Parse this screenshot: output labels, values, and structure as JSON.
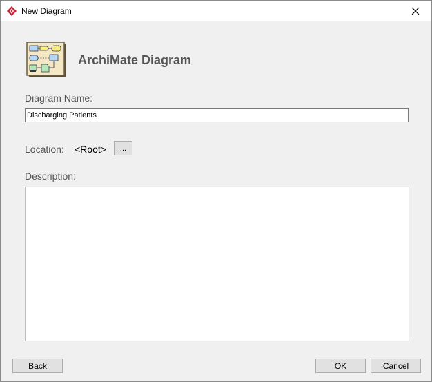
{
  "window": {
    "title": "New Diagram",
    "app_icon": "visual-paradigm-diamond-icon",
    "close_icon": "close-icon"
  },
  "header": {
    "title": "ArchiMate Diagram",
    "icon": "archimate-diagram-icon"
  },
  "form": {
    "name_label": "Diagram Name:",
    "name_value": "Discharging Patients",
    "location_label": "Location:",
    "location_value": "<Root>",
    "browse_label": "...",
    "description_label": "Description:",
    "description_value": ""
  },
  "buttons": {
    "back": "Back",
    "ok": "OK",
    "cancel": "Cancel"
  },
  "colors": {
    "dialog_background": "#f0f0f0",
    "label_text": "#555555",
    "app_icon_red": "#c8253a"
  }
}
